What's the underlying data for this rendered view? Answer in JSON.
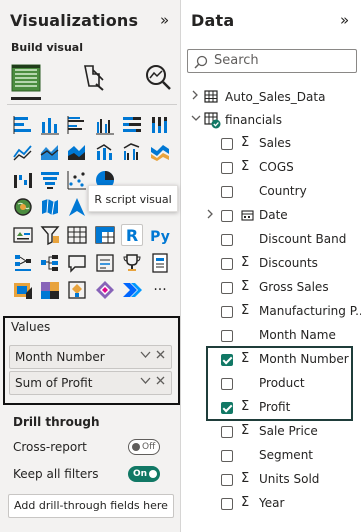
{
  "viz_pane": {
    "title": "Visualizations",
    "build_visual_label": "Build visual",
    "tooltip": "R script visual",
    "values_label": "Values",
    "values_fields": [
      "Month Number",
      "Sum of Profit"
    ],
    "drill_through_title": "Drill through",
    "cross_report_label": "Cross-report",
    "cross_report_state": "Off",
    "keep_filters_label": "Keep all filters",
    "keep_filters_state": "On",
    "add_drill_button": "Add drill-through fields here",
    "r_label": "R",
    "py_label": "Py",
    "more_label": "···"
  },
  "data_pane": {
    "title": "Data",
    "search_placeholder": "Search",
    "tables": [
      "Auto_Sales_Data",
      "financials"
    ],
    "fields": [
      {
        "name": "Sales",
        "sigma": true,
        "checked": false,
        "expandable": false
      },
      {
        "name": "COGS",
        "sigma": true,
        "checked": false,
        "expandable": false
      },
      {
        "name": "Country",
        "sigma": false,
        "checked": false,
        "expandable": false
      },
      {
        "name": "Date",
        "sigma": false,
        "checked": false,
        "expandable": true
      },
      {
        "name": "Discount Band",
        "sigma": false,
        "checked": false,
        "expandable": false
      },
      {
        "name": "Discounts",
        "sigma": true,
        "checked": false,
        "expandable": false
      },
      {
        "name": "Gross Sales",
        "sigma": true,
        "checked": false,
        "expandable": false
      },
      {
        "name": "Manufacturing P...",
        "sigma": true,
        "checked": false,
        "expandable": false
      },
      {
        "name": "Month Name",
        "sigma": false,
        "checked": false,
        "expandable": false
      },
      {
        "name": "Month Number",
        "sigma": true,
        "checked": true,
        "expandable": false
      },
      {
        "name": "Product",
        "sigma": false,
        "checked": false,
        "expandable": false
      },
      {
        "name": "Profit",
        "sigma": true,
        "checked": true,
        "expandable": false
      },
      {
        "name": "Sale Price",
        "sigma": true,
        "checked": false,
        "expandable": false
      },
      {
        "name": "Segment",
        "sigma": false,
        "checked": false,
        "expandable": false
      },
      {
        "name": "Units Sold",
        "sigma": true,
        "checked": false,
        "expandable": false
      },
      {
        "name": "Year",
        "sigma": true,
        "checked": false,
        "expandable": false
      }
    ]
  },
  "colors": {
    "accent": "#117865",
    "pane_bg": "#f3f2f1",
    "viz_blue": "#0078d4",
    "viz_orange": "#e8a33d",
    "viz_purple": "#8764b8"
  }
}
